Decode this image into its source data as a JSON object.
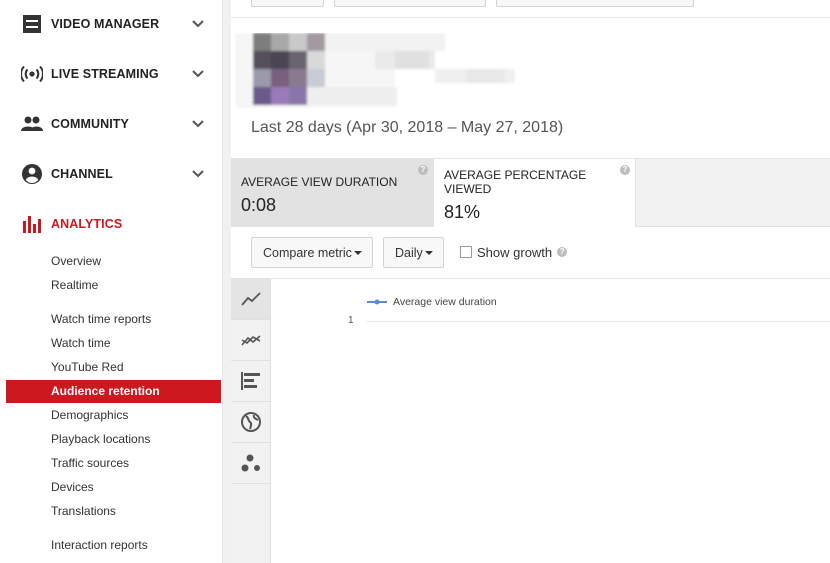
{
  "sidebar": {
    "sections": [
      {
        "label": "VIDEO MANAGER",
        "icon": "video-manager-icon"
      },
      {
        "label": "LIVE STREAMING",
        "icon": "live-streaming-icon"
      },
      {
        "label": "COMMUNITY",
        "icon": "community-icon"
      },
      {
        "label": "CHANNEL",
        "icon": "channel-icon"
      },
      {
        "label": "ANALYTICS",
        "icon": "analytics-icon"
      }
    ],
    "analytics_items": [
      {
        "label": "Overview"
      },
      {
        "label": "Realtime"
      },
      {
        "label": "Watch time reports"
      },
      {
        "label": "Watch time"
      },
      {
        "label": "YouTube Red"
      },
      {
        "label": "Audience retention",
        "active": true
      },
      {
        "label": "Demographics"
      },
      {
        "label": "Playback locations"
      },
      {
        "label": "Traffic sources"
      },
      {
        "label": "Devices"
      },
      {
        "label": "Translations"
      },
      {
        "label": "Interaction reports"
      }
    ]
  },
  "main": {
    "date_range": "Last 28 days (Apr 30, 2018 – May 27, 2018)",
    "metrics": [
      {
        "label": "AVERAGE VIEW DURATION",
        "value": "0:08",
        "selected": true
      },
      {
        "label": "AVERAGE PERCENTAGE VIEWED",
        "value": "81%",
        "selected": false
      }
    ],
    "metric_help_glyph": "?",
    "controls": {
      "compare_metric": "Compare metric",
      "interval": "Daily",
      "show_growth": "Show growth",
      "show_growth_checked": false
    },
    "chart_types": [
      "line-chart-icon",
      "multiline-chart-icon",
      "bar-chart-icon",
      "globe-map-icon",
      "bubble-chart-icon"
    ]
  },
  "chart_data": {
    "type": "line",
    "series": [
      {
        "name": "Average view duration",
        "values": []
      }
    ],
    "y_ticks": [
      "1"
    ]
  },
  "colors": {
    "accent": "#cc181e",
    "series_line": "#5b8bd0"
  }
}
